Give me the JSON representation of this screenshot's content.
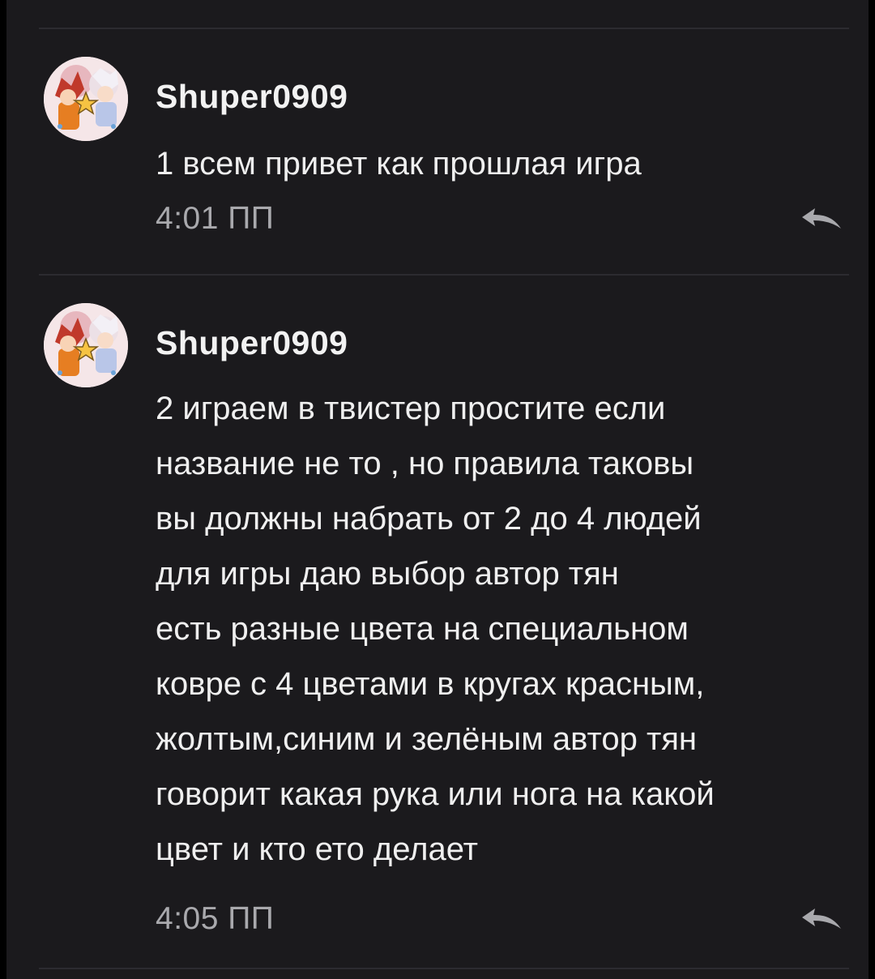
{
  "messages": [
    {
      "author": "Shuper0909",
      "lines": [
        "1 всем привет как прошлая игра"
      ],
      "time": "4:01 ПП"
    },
    {
      "author": "Shuper0909",
      "lines": [
        "2 играем в твистер простите если",
        "название не то , но правила таковы",
        "вы должны набрать от 2 до 4 людей",
        "для игры даю выбор автор тян",
        "есть разные цвета на специальном",
        "ковре с 4 цветами в кругах красным,",
        "жолтым,синим и зелёным  автор тян",
        "говорит какая рука или нога на какой",
        "цвет и кто ето делает"
      ],
      "time": "4:05 ПП"
    }
  ],
  "icons": {
    "avatar": "anime-avatar-icon",
    "reply": "reply-arrow-icon"
  },
  "colors": {
    "background": "#1b1a1d",
    "text": "#efefef",
    "timestamp": "#a9a9ad",
    "divider": "#2c2b30"
  }
}
